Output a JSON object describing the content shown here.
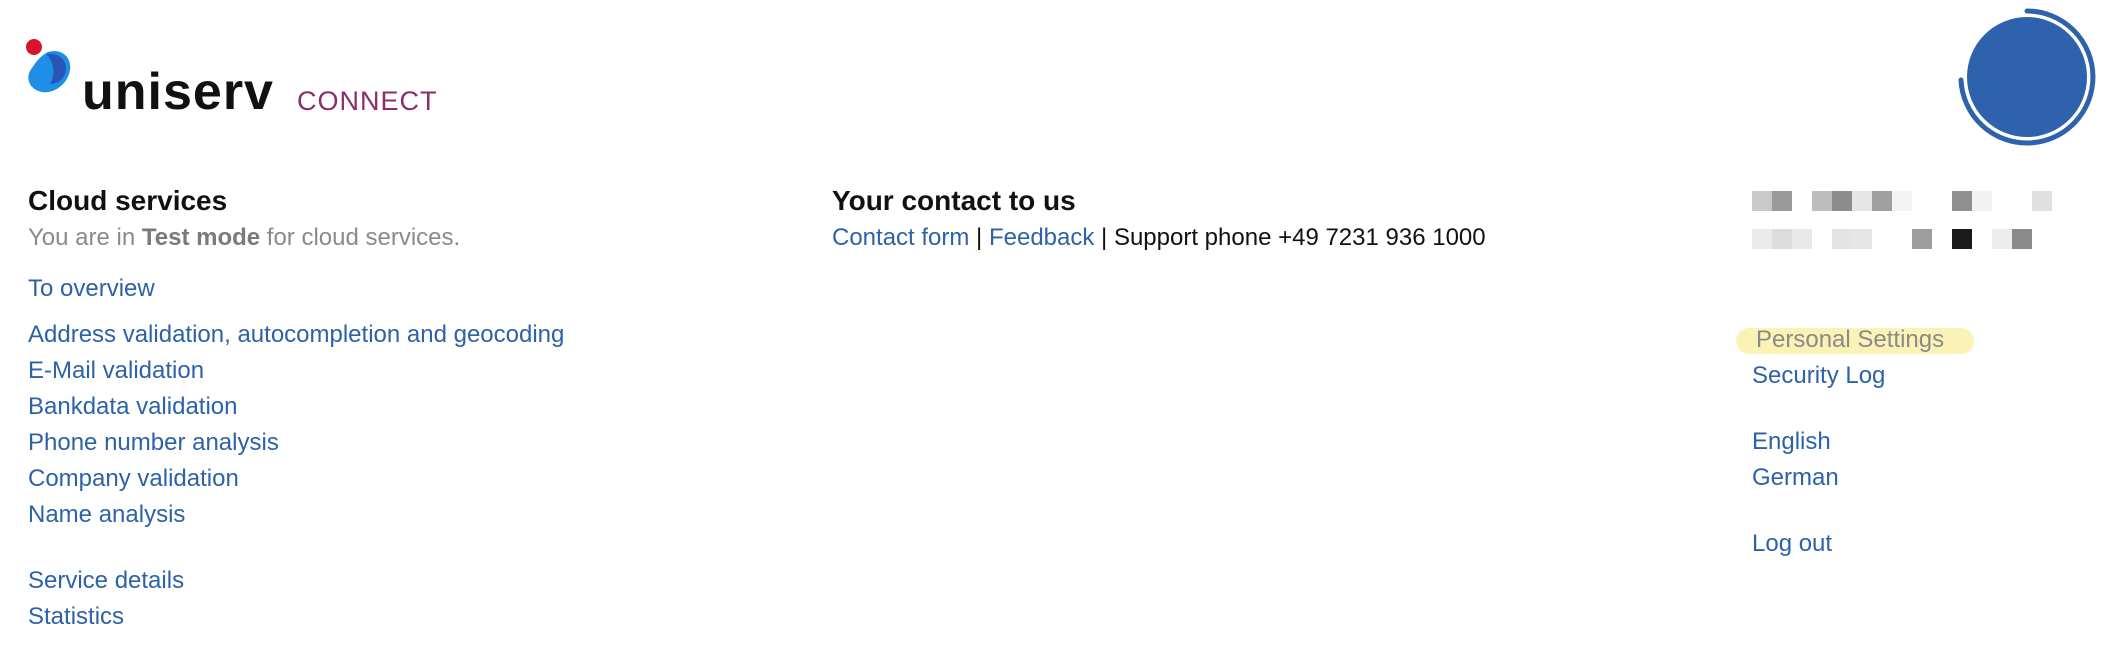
{
  "brand": {
    "name": "uniserv",
    "sub": "CONNECT",
    "colors": {
      "dot_red": "#d8142d",
      "dot_blue": "#1e8ee6",
      "sub": "#8a2c6e"
    }
  },
  "cloud": {
    "heading": "Cloud services",
    "mode_prefix": "You are in ",
    "mode_bold": "Test mode",
    "mode_suffix": " for cloud services.",
    "overview": "To overview",
    "services": [
      "Address validation, autocompletion and geocoding",
      "E-Mail validation",
      "Bankdata validation",
      "Phone number analysis",
      "Company validation",
      "Name analysis"
    ],
    "details": [
      "Service details",
      "Statistics"
    ]
  },
  "contact": {
    "heading": "Your contact to us",
    "form": "Contact form",
    "sep1": " | ",
    "feedback": "Feedback",
    "support": " | Support phone +49 7231 936 1000"
  },
  "user": {
    "personal_settings": "Personal Settings",
    "security_log": "Security Log",
    "lang_en": "English",
    "lang_de": "German",
    "logout": "Log out"
  },
  "colors": {
    "link": "#2d62a8",
    "avatar": "#2f62ac",
    "highlight": "#fbf3b6"
  }
}
